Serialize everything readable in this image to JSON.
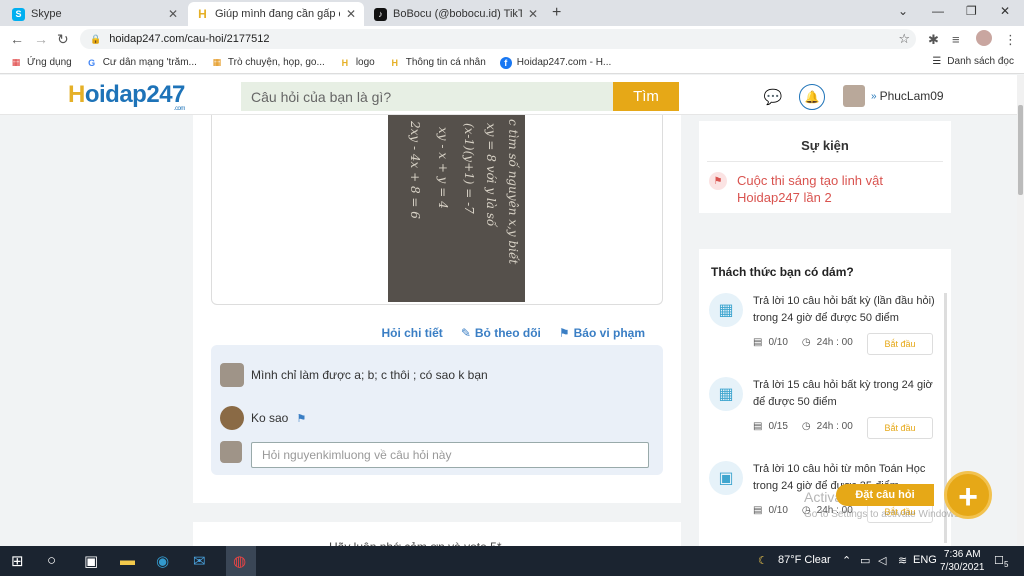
{
  "browser": {
    "tabs": [
      {
        "title": "Skype",
        "icon": "skype-icon"
      },
      {
        "title": "Giúp mình đang cần gấp câu hỏi",
        "icon": "hoidap-icon"
      },
      {
        "title": "BoBocu (@bobocu.id) TikTok | Xe",
        "icon": "tiktok-icon"
      }
    ],
    "url": "hoidap247.com/cau-hoi/2177512",
    "bookmarks": [
      {
        "label": "Ứng dụng"
      },
      {
        "label": "Cư dân mạng 'trăm..."
      },
      {
        "label": "Trò chuyện, họp, go..."
      },
      {
        "label": "logo"
      },
      {
        "label": "Thông tin cá nhân"
      },
      {
        "label": "Hoidap247.com - H..."
      }
    ],
    "reading_list": "Danh sách đọc"
  },
  "header": {
    "logo_h": "H",
    "logo_rest": "oidap247",
    "logo_sub": ".com",
    "search_placeholder": "Câu hỏi của bạn là gì?",
    "search_button": "Tìm",
    "username": "PhucLam09"
  },
  "question": {
    "handwriting": [
      "c tìm số nguyên x,y biết",
      "xy = 8 với y là số",
      "(x-1)(y+1) = -7",
      "xy - x + y = 4",
      "2xy - 4x + 8 = 6"
    ],
    "actions": {
      "detail": "Hỏi chi tiết",
      "unfollow": "Bỏ theo dõi",
      "report": "Báo vi phạm"
    }
  },
  "comments": {
    "items": [
      {
        "text": "Mình chỉ làm được a; b; c thôi ; có sao k bạn"
      },
      {
        "text": "Ko sao"
      }
    ],
    "input_placeholder": "Hỏi nguyenkimluong về câu hỏi này"
  },
  "main_footer_text": "Hãy luôn nhớ cảm ơn và vote 5*",
  "events": {
    "title": "Sự kiện",
    "link": "Cuộc thi sáng tạo linh vật Hoidap247 lần 2"
  },
  "challenges": {
    "title": "Thách thức bạn có dám?",
    "items": [
      {
        "text": "Trả lời 10 câu hỏi bất kỳ (lần đầu hỏi) trong 24 giờ để được 50 điểm",
        "progress": "0/10",
        "time": "24h : 00",
        "button": "Bắt đầu"
      },
      {
        "text": "Trả lời 15 câu hỏi bất kỳ trong 24 giờ để được 50 điểm",
        "progress": "0/15",
        "time": "24h : 00",
        "button": "Bắt đầu"
      },
      {
        "text": "Trả lời 10 câu hỏi từ môn Toán Học trong 24 giờ để được 35 điểm",
        "progress": "0/10",
        "time": "24h : 00",
        "button": "Bắt đầu"
      }
    ]
  },
  "ask_button": "Đặt câu hỏi",
  "watermark": {
    "title": "Activate Windows",
    "sub": "Go to Settings to activate Windows."
  },
  "taskbar": {
    "weather": "87°F  Clear",
    "lang": "ENG",
    "time": "7:36 AM",
    "date": "7/30/2021",
    "notifications": "5"
  }
}
